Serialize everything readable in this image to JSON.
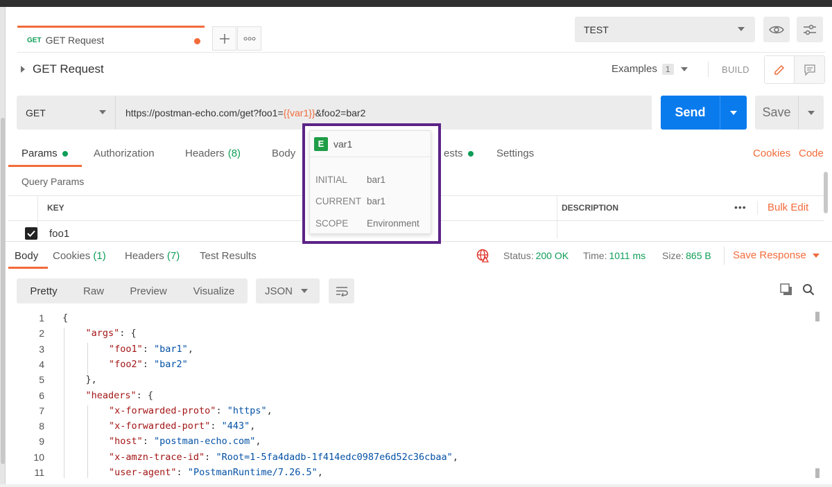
{
  "tab": {
    "method": "GET",
    "name": "GET Request"
  },
  "environment": {
    "selected": "TEST"
  },
  "request": {
    "name": "GET Request",
    "examples_label": "Examples",
    "examples_count": "1",
    "build_label": "BUILD",
    "method": "GET",
    "url_prefix": "https://postman-echo.com/get?foo1=",
    "url_var": "{{var1}}",
    "url_suffix": "&foo2=bar2",
    "send_label": "Send",
    "save_label": "Save"
  },
  "request_tabs": {
    "params": "Params",
    "authorization": "Authorization",
    "headers": "Headers",
    "headers_count": "(8)",
    "body": "Body",
    "tests_suffix": "ests",
    "settings": "Settings",
    "cookies": "Cookies",
    "code": "Code"
  },
  "query_params": {
    "title": "Query Params",
    "col_key": "KEY",
    "col_description": "DESCRIPTION",
    "more": "•••",
    "bulk_edit": "Bulk Edit",
    "rows": [
      {
        "key": "foo1",
        "checked": true
      }
    ]
  },
  "variable_popover": {
    "scope_badge": "E",
    "name": "var1",
    "initial_label": "INITIAL",
    "initial_value": "bar1",
    "current_label": "CURRENT",
    "current_value": "bar1",
    "scope_label": "SCOPE",
    "scope_value": "Environment"
  },
  "response_tabs": {
    "body": "Body",
    "cookies": "Cookies",
    "cookies_count": "(1)",
    "headers": "Headers",
    "headers_count": "(7)",
    "test_results": "Test Results"
  },
  "response_status": {
    "status_label": "Status:",
    "status_value": "200 OK",
    "time_label": "Time:",
    "time_value": "1011 ms",
    "size_label": "Size:",
    "size_value": "865 B",
    "save_response": "Save Response"
  },
  "format": {
    "options": [
      "Pretty",
      "Raw",
      "Preview",
      "Visualize"
    ],
    "active": "Pretty",
    "language": "JSON"
  },
  "colors": {
    "accent": "#f26b3a",
    "send_blue": "#097bed",
    "success_green": "#0f9d58",
    "popover_border": "#5c2387"
  },
  "response_body": {
    "lines": [
      {
        "n": "1",
        "indent": 0,
        "parts": [
          [
            "p",
            "{"
          ]
        ]
      },
      {
        "n": "2",
        "indent": 1,
        "parts": [
          [
            "k",
            "\"args\""
          ],
          [
            "p",
            ": {"
          ]
        ]
      },
      {
        "n": "3",
        "indent": 2,
        "parts": [
          [
            "k",
            "\"foo1\""
          ],
          [
            "p",
            ": "
          ],
          [
            "s",
            "\"bar1\""
          ],
          [
            "p",
            ","
          ]
        ]
      },
      {
        "n": "4",
        "indent": 2,
        "parts": [
          [
            "k",
            "\"foo2\""
          ],
          [
            "p",
            ": "
          ],
          [
            "s",
            "\"bar2\""
          ]
        ]
      },
      {
        "n": "5",
        "indent": 1,
        "parts": [
          [
            "p",
            "},"
          ]
        ]
      },
      {
        "n": "6",
        "indent": 1,
        "parts": [
          [
            "k",
            "\"headers\""
          ],
          [
            "p",
            ": {"
          ]
        ]
      },
      {
        "n": "7",
        "indent": 2,
        "parts": [
          [
            "k",
            "\"x-forwarded-proto\""
          ],
          [
            "p",
            ": "
          ],
          [
            "s",
            "\"https\""
          ],
          [
            "p",
            ","
          ]
        ]
      },
      {
        "n": "8",
        "indent": 2,
        "parts": [
          [
            "k",
            "\"x-forwarded-port\""
          ],
          [
            "p",
            ": "
          ],
          [
            "s",
            "\"443\""
          ],
          [
            "p",
            ","
          ]
        ]
      },
      {
        "n": "9",
        "indent": 2,
        "parts": [
          [
            "k",
            "\"host\""
          ],
          [
            "p",
            ": "
          ],
          [
            "s",
            "\"postman-echo.com\""
          ],
          [
            "p",
            ","
          ]
        ]
      },
      {
        "n": "10",
        "indent": 2,
        "parts": [
          [
            "k",
            "\"x-amzn-trace-id\""
          ],
          [
            "p",
            ": "
          ],
          [
            "s",
            "\"Root=1-5fa4dadb-1f414edc0987e6d52c36cbaa\""
          ],
          [
            "p",
            ","
          ]
        ]
      },
      {
        "n": "11",
        "indent": 2,
        "parts": [
          [
            "k",
            "\"user-agent\""
          ],
          [
            "p",
            ": "
          ],
          [
            "s",
            "\"PostmanRuntime/7.26.5\""
          ],
          [
            "p",
            ","
          ]
        ]
      }
    ]
  }
}
